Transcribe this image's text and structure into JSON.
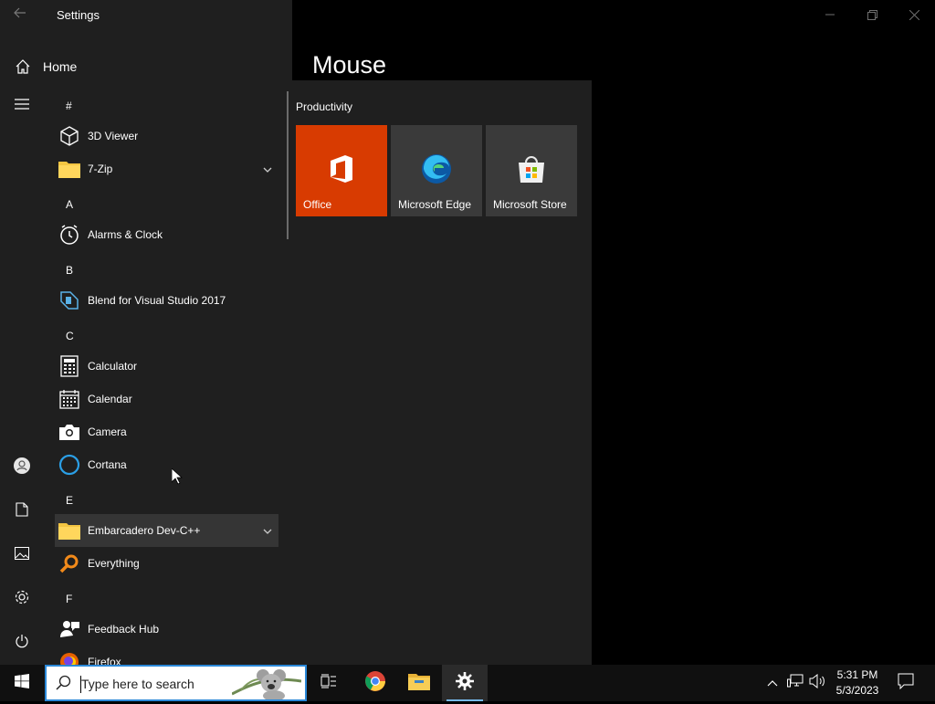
{
  "settings_window": {
    "title": "Settings",
    "home_label": "Home",
    "page_title": "Mouse"
  },
  "start_menu": {
    "app_list": [
      {
        "type": "header",
        "text": "#"
      },
      {
        "type": "app",
        "label": "3D Viewer",
        "icon": "cube-icon"
      },
      {
        "type": "app",
        "label": "7-Zip",
        "icon": "folder-icon",
        "expandable": true
      },
      {
        "type": "header",
        "text": "A"
      },
      {
        "type": "app",
        "label": "Alarms & Clock",
        "icon": "clock-icon"
      },
      {
        "type": "header",
        "text": "B"
      },
      {
        "type": "app",
        "label": "Blend for Visual Studio 2017",
        "icon": "blend-icon"
      },
      {
        "type": "header",
        "text": "C"
      },
      {
        "type": "app",
        "label": "Calculator",
        "icon": "calculator-icon"
      },
      {
        "type": "app",
        "label": "Calendar",
        "icon": "calendar-icon"
      },
      {
        "type": "app",
        "label": "Camera",
        "icon": "camera-icon"
      },
      {
        "type": "app",
        "label": "Cortana",
        "icon": "cortana-icon"
      },
      {
        "type": "header",
        "text": "E"
      },
      {
        "type": "app",
        "label": "Embarcadero Dev-C++",
        "icon": "folder-icon",
        "expandable": true,
        "highlighted": true
      },
      {
        "type": "app",
        "label": "Everything",
        "icon": "magnifier-icon"
      },
      {
        "type": "header",
        "text": "F"
      },
      {
        "type": "app",
        "label": "Feedback Hub",
        "icon": "feedback-icon"
      },
      {
        "type": "app",
        "label": "Firefox",
        "icon": "firefox-icon"
      }
    ],
    "tiles_group_title": "Productivity",
    "tiles": [
      {
        "label": "Office",
        "icon": "office-icon",
        "color": "#d83b01"
      },
      {
        "label": "Microsoft Edge",
        "icon": "edge-icon",
        "color": "#3a3a3a"
      },
      {
        "label": "Microsoft Store",
        "icon": "store-icon",
        "color": "#3a3a3a"
      }
    ],
    "rail_icons": [
      "hamburger-icon",
      "user-icon",
      "documents-icon",
      "pictures-icon",
      "settings-icon",
      "power-icon"
    ]
  },
  "taskbar": {
    "search_placeholder": "Type here to search",
    "time": "5:31 PM",
    "date": "5/3/2023"
  },
  "colors": {
    "accent": "#2b88d8",
    "office_tile": "#d83b01",
    "menu_bg": "#1f1f1f"
  }
}
